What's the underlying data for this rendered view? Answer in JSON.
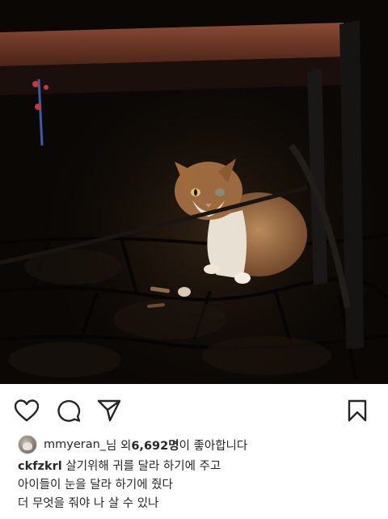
{
  "post": {
    "image": {
      "alt_semantic": "calico-cat-under-bench-photo"
    },
    "actions": {
      "like_icon": "heart-icon",
      "comment_icon": "comment-icon",
      "share_icon": "send-icon",
      "save_icon": "bookmark-icon"
    },
    "likes": {
      "username": "mmyeran_",
      "text_after_username": "님 외 ",
      "count": "6,692명",
      "text_after_count": "이 좋아합니다"
    },
    "caption": {
      "username": "ckfzkrl",
      "line1": " 살기위해 귀를 달라 하기에 주고",
      "line2": "아이들이 눈을 달라 하기에 줬다",
      "line3": "더 무엇을 줘야 나 살 수 있나"
    }
  },
  "colors": {
    "text": "#262626",
    "background": "#ffffff"
  }
}
